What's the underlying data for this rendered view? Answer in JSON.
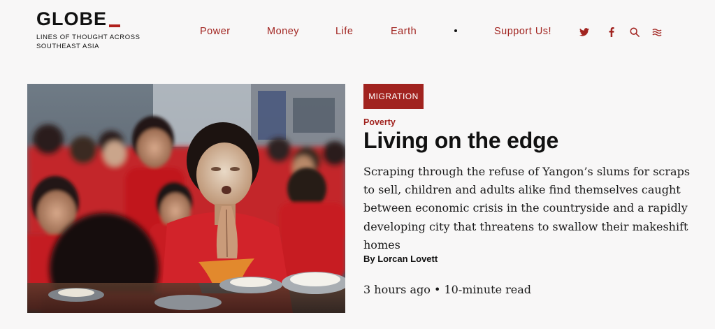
{
  "site": {
    "logo": "GLOBE",
    "tagline": "LINES OF THOUGHT ACROSS SOUTHEAST ASIA"
  },
  "nav": {
    "items": [
      {
        "label": "Power"
      },
      {
        "label": "Money"
      },
      {
        "label": "Life"
      },
      {
        "label": "Earth"
      }
    ],
    "support_label": "Support Us!",
    "icons": [
      "twitter-icon",
      "facebook-icon",
      "search-icon",
      "menu-icon"
    ]
  },
  "article": {
    "tag": "MIGRATION",
    "kicker": "Poverty",
    "headline": "Living on the edge",
    "dek": "Scraping through the refuse of Yangon’s slums for scraps to sell, children and adults alike find themselves caught between economic crisis in the countryside and a rapidly developing city that threatens to swallow their makeshift homes",
    "byline": "By Lorcan Lovett",
    "time_ago": "3 hours ago",
    "separator": "•",
    "read_time": "10-minute read"
  },
  "colors": {
    "accent": "#a1231f",
    "background": "#f8f7f7",
    "text": "#111111"
  }
}
